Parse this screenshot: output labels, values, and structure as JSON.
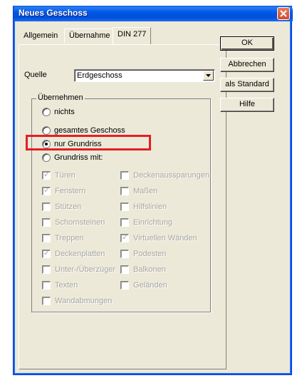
{
  "window": {
    "title": "Neues Geschoss"
  },
  "tabs": [
    {
      "label": "Allgemein"
    },
    {
      "label": "Übernahme"
    },
    {
      "label": "DIN 277"
    }
  ],
  "buttons": {
    "ok": "OK",
    "cancel": "Abbrechen",
    "standard": "als Standard",
    "help": "Hilfe"
  },
  "source": {
    "label": "Quelle",
    "value": "Erdgeschoss"
  },
  "group": {
    "legend": "Übernehmen",
    "radios": [
      {
        "label": "nichts",
        "checked": false
      },
      {
        "label": "gesamtes Geschoss",
        "checked": false
      },
      {
        "label": "nur Grundriss",
        "checked": true
      },
      {
        "label": "Grundriss mit:",
        "checked": false
      }
    ]
  },
  "options_left": [
    {
      "label": "Türen",
      "checked": true
    },
    {
      "label": "Fenstern",
      "checked": true
    },
    {
      "label": "Stützen",
      "checked": false
    },
    {
      "label": "Schornsteinen",
      "checked": false
    },
    {
      "label": "Treppen",
      "checked": false
    },
    {
      "label": "Deckenplatten",
      "checked": true
    },
    {
      "label": "Unter-/Überzüger",
      "checked": false
    },
    {
      "label": "Texten",
      "checked": false
    },
    {
      "label": "Wandabmungen",
      "checked": false
    }
  ],
  "options_right": [
    {
      "label": "Deckenaussparungen",
      "checked": false
    },
    {
      "label": "Maßen",
      "checked": false
    },
    {
      "label": "Hilfslinien",
      "checked": false
    },
    {
      "label": "Einrichtung",
      "checked": false
    },
    {
      "label": "Virtuellen Wänden",
      "checked": true
    },
    {
      "label": "Podesten",
      "checked": false
    },
    {
      "label": "Balkonen",
      "checked": false
    },
    {
      "label": "Geländen",
      "checked": false
    }
  ],
  "annotation": {
    "color": "#e41e24"
  }
}
